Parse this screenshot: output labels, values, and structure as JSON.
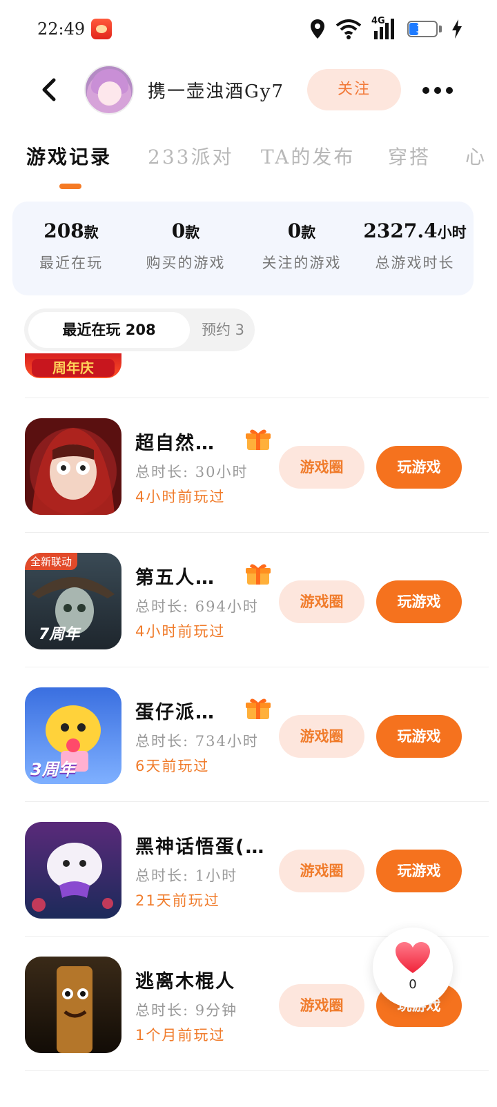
{
  "status_bar": {
    "time": "22:49",
    "network": "4G",
    "battery": "31"
  },
  "header": {
    "username": "携一壶浊酒Gy7",
    "follow_label": "关注"
  },
  "tabs": [
    {
      "label": "游戏记录"
    },
    {
      "label": "233派对"
    },
    {
      "label": "TA的发布"
    },
    {
      "label": "穿搭"
    },
    {
      "label": "心"
    }
  ],
  "stats": [
    {
      "value": "208",
      "unit": "款",
      "label": "最近在玩"
    },
    {
      "value": "0",
      "unit": "款",
      "label": "购买的游戏"
    },
    {
      "value": "0",
      "unit": "款",
      "label": "关注的游戏"
    },
    {
      "value": "2327.4",
      "unit": "小时",
      "label": "总游戏时长"
    }
  ],
  "segments": {
    "recent": "最近在玩 208",
    "reserved": "预约 3"
  },
  "partial_icon_text": "周年庆",
  "games": [
    {
      "title": "超自然…",
      "duration": "总时长: 30小时",
      "last_played": "4小时前玩过",
      "circle_label": "游戏圈",
      "play_label": "玩游戏"
    },
    {
      "title": "第五人…",
      "duration": "总时长: 694小时",
      "last_played": "4小时前玩过",
      "circle_label": "游戏圈",
      "play_label": "玩游戏",
      "icon_badge": "全新联动",
      "icon_caption": "7周年"
    },
    {
      "title": "蛋仔派…",
      "duration": "总时长: 734小时",
      "last_played": "6天前玩过",
      "circle_label": "游戏圈",
      "play_label": "玩游戏",
      "icon_caption": "3周年"
    },
    {
      "title": "黑神话悟蛋(…",
      "duration": "总时长: 1小时",
      "last_played": "21天前玩过",
      "circle_label": "游戏圈",
      "play_label": "玩游戏"
    },
    {
      "title": "逃离木棍人",
      "duration": "总时长: 9分钟",
      "last_played": "1个月前玩过",
      "circle_label": "游戏圈",
      "play_label": "玩游戏"
    }
  ],
  "like": {
    "count": "0"
  }
}
